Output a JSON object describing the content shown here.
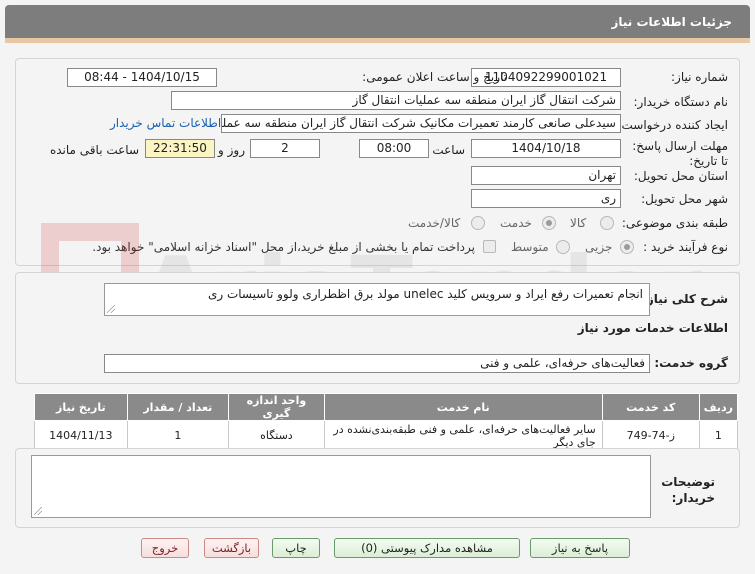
{
  "page": {
    "title": "جزئیات اطلاعات نیاز"
  },
  "fields": {
    "need_number_label": "شماره نیاز:",
    "need_number": "1104092299001021",
    "announce_label": "تاریخ و ساعت اعلان عمومی:",
    "announce_value": "1404/10/15 - 08:44",
    "buyer_label": "نام دستگاه خریدار:",
    "buyer_value": "شرکت انتقال گاز ایران منطقه سه عملیات انتقال گاز",
    "creator_label": "ایجاد کننده درخواست:",
    "creator_value": "سیدعلی صانعی کارمند تعمیرات مکانیک شرکت انتقال گاز ایران منطقه سه عملیات انتقال گاز",
    "contact_link": "اطلاعات تماس خریدار",
    "deadline_label": "مهلت ارسال پاسخ: تا تاریخ:",
    "deadline_date": "1404/10/18",
    "time_label": "ساعت",
    "deadline_time": "08:00",
    "days_value": "2",
    "days_label": "روز و",
    "remaining_time": "22:31:50",
    "remaining_label": "ساعت باقی مانده",
    "province_label": "استان محل تحویل:",
    "province_value": "تهران",
    "city_label": "شهر محل تحویل:",
    "city_value": "ری",
    "category_label": "طبقه بندی موضوعی:",
    "category_options": [
      "کالا",
      "خدمت",
      "کالا/خدمت"
    ],
    "category_selected": "خدمت",
    "process_label": "نوع فرآیند خرید :",
    "process_options": [
      "جزیی",
      "متوسط"
    ],
    "process_selected": "جزیی",
    "payment_note": "پرداخت تمام یا بخشی از مبلغ خرید،از محل \"اسناد خزانه اسلامی\" خواهد بود."
  },
  "summary": {
    "label": "شرح کلی نیاز:",
    "value": "انجام تعمیرات رفع ایراد و سرویس کلید unelec مولد برق اظطراری ولوو تاسیسات ری"
  },
  "services": {
    "section_title": "اطلاعات خدمات مورد نیاز",
    "group_label": "گروه خدمت:",
    "group_value": "فعالیت‌های حرفه‌ای، علمی و فنی",
    "table": {
      "headers": [
        "ردیف",
        "کد خدمت",
        "نام خدمت",
        "واحد اندازه گیری",
        "تعداد / مقدار",
        "تاریخ نیاز"
      ],
      "rows": [
        [
          "1",
          "ز-74-749",
          "سایر فعالیت‌های حرفه‌ای، علمی و فنی طبقه‌بندی‌نشده در جای دیگر",
          "دستگاه",
          "1",
          "1404/11/13"
        ]
      ]
    }
  },
  "buyer_notes": {
    "label": "توضیحات خریدار:",
    "value": ""
  },
  "watermark": {
    "text": "AriaTender.neT"
  },
  "buttons": {
    "reply": "پاسخ به نیاز",
    "attachments": "مشاهده مدارک پیوستی (0)",
    "print": "چاپ",
    "back": "بازگشت",
    "exit": "خروج"
  },
  "colors": {
    "header_bg": "#7d7d7d",
    "header_border": "#e8c7a4",
    "link": "#1a5fb4",
    "table_header": "#8a8a8a"
  }
}
